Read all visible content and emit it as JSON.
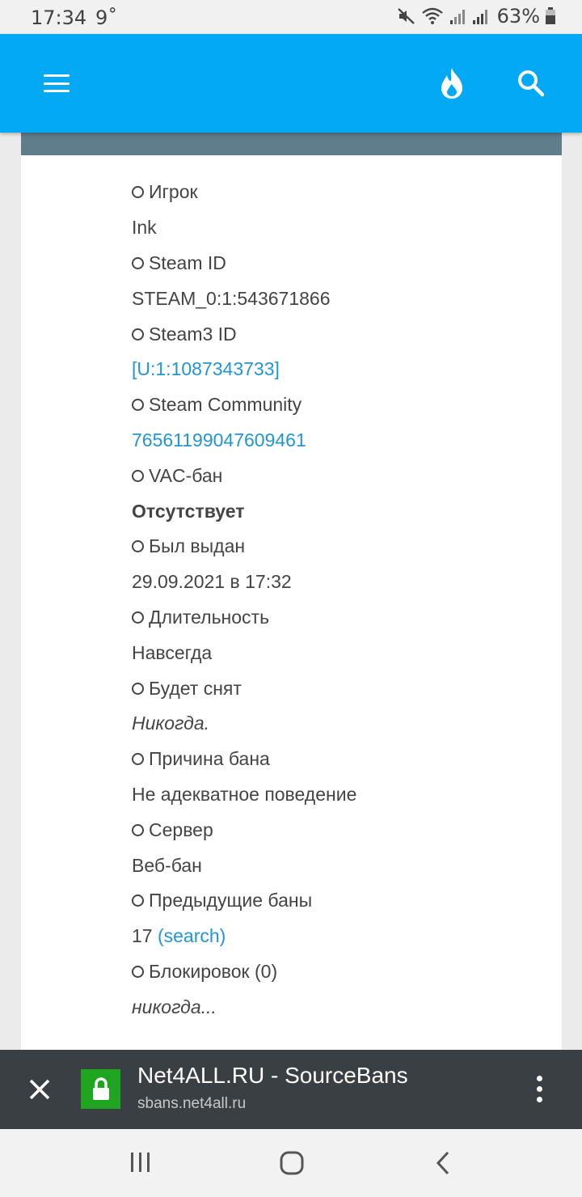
{
  "status_bar": {
    "time": "17:34",
    "temperature": "9˚",
    "battery": "63%"
  },
  "app_bar": {
    "icons": [
      "menu-icon",
      "fire-icon",
      "search-icon"
    ],
    "color": "#03a9f4"
  },
  "details": [
    {
      "label": "Игрок",
      "value": "Ink",
      "style": "normal"
    },
    {
      "label": "Steam ID",
      "value": "STEAM_0:1:543671866",
      "style": "normal"
    },
    {
      "label": "Steam3 ID",
      "value": "[U:1:1087343733]",
      "style": "link"
    },
    {
      "label": "Steam Community",
      "value": "76561199047609461",
      "style": "link"
    },
    {
      "label": "VAC-бан",
      "value": "Отсутствует",
      "style": "bold"
    },
    {
      "label": "Был выдан",
      "value": "29.09.2021 в 17:32",
      "style": "normal"
    },
    {
      "label": "Длительность",
      "value": "Навсегда",
      "style": "normal"
    },
    {
      "label": "Будет снят",
      "value": "Никогда.",
      "style": "italic"
    },
    {
      "label": "Причина бана",
      "value": "Не адекватное поведение",
      "style": "normal"
    },
    {
      "label": "Сервер",
      "value": "Веб-бан",
      "style": "normal"
    },
    {
      "label": "Предыдущие баны",
      "value": "17",
      "extra_link": "(search)",
      "style": "normal"
    },
    {
      "label": "Блокировок (0)",
      "value": "никогда...",
      "style": "italic"
    }
  ],
  "tab_bar": {
    "title": "Net4ALL.RU - SourceBans",
    "url": "sbans.net4all.ru"
  }
}
